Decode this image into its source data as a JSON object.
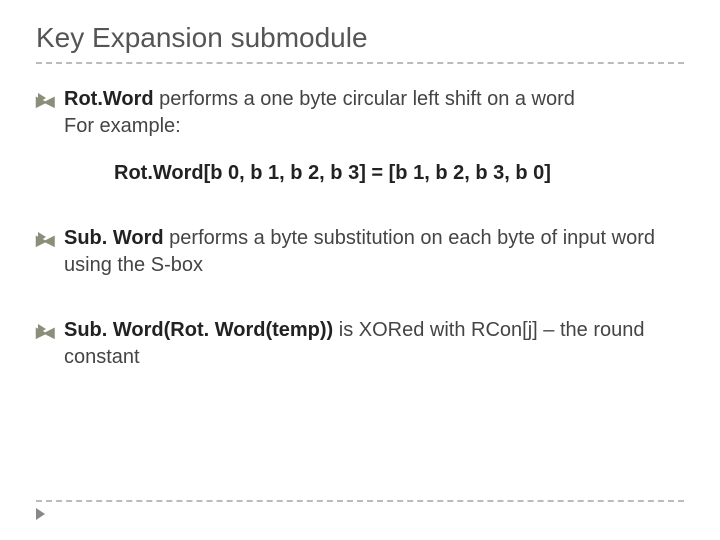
{
  "title": "Key Expansion submodule",
  "bullets": [
    {
      "term": "Rot.Word",
      "text_after": " performs a one byte circular left shift on a word",
      "subtext": "For example:",
      "formula": "Rot.Word[b 0, b 1, b 2, b 3] = [b 1, b 2, b 3, b 0]"
    },
    {
      "term": "Sub. Word",
      "text_after": " performs a byte substitution on each byte of input word using the S-box"
    },
    {
      "term": "Sub. Word(Rot. Word(temp))",
      "text_after": " is XORed with RCon[j] – the round constant"
    }
  ]
}
